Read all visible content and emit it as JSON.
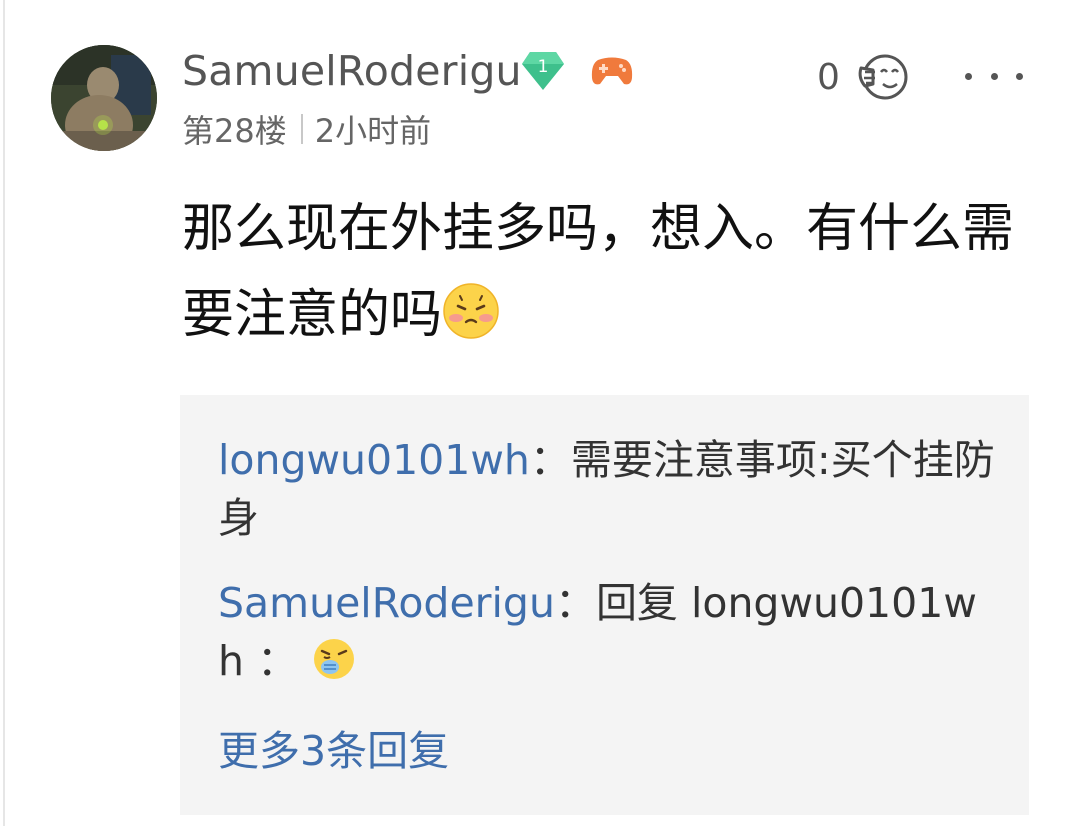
{
  "post": {
    "author": "SamuelRoderigu",
    "level": "1",
    "floor": "第28楼",
    "time": "2小时前",
    "like_count": "0",
    "content": "那么现在外挂多吗，想入。有什么需要注意的吗",
    "content_emoji": "embarrassed-emoji"
  },
  "replies": [
    {
      "user": "longwu0101wh",
      "separator": "：",
      "text": "需要注意事项:买个挂防身"
    },
    {
      "user": "SamuelRoderigu",
      "separator": "：",
      "text": "回复 longwu0101wh ：",
      "emoji": "sneezing-emoji"
    }
  ],
  "more_replies_label": "更多3条回复",
  "colors": {
    "link_blue": "#3f6eac",
    "badge_green": "#3ec08c",
    "reply_bg": "#f4f4f4",
    "game_icon_orange": "#f07a3c"
  },
  "icons": {
    "level_badge": "diamond-level-badge-icon",
    "game": "gamepad-icon",
    "like": "like-face-icon",
    "more": "more-dots-icon"
  }
}
